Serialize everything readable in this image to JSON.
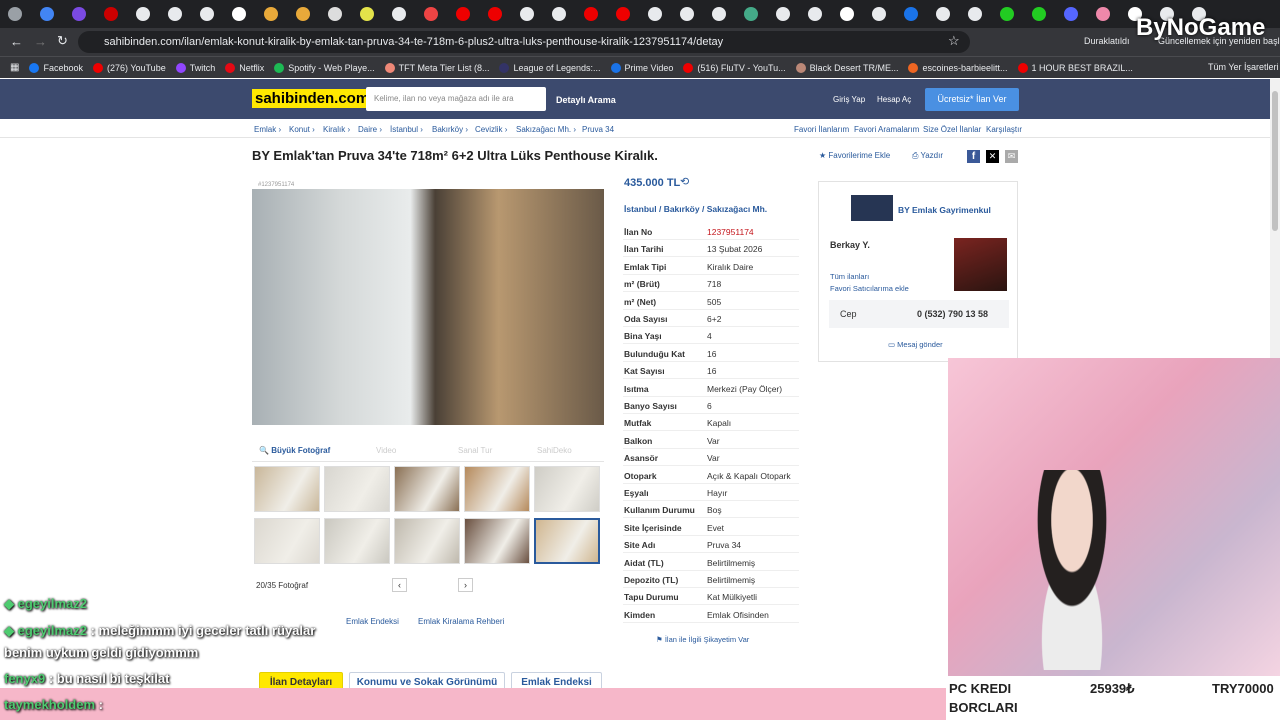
{
  "browser": {
    "url": "sahibinden.com/ilan/emlak-konut-kiralik-by-emlak-tan-pruva-34-te-718m-6-plus2-ultra-luks-penthouse-kiralik-1237951174/detay",
    "profile_label": "Duraklatıldı",
    "update_label": "Güncellemek için yeniden başlat",
    "bookmarks": [
      "Facebook",
      "(276) YouTube",
      "Twitch",
      "Netflix",
      "Spotify - Web Playe...",
      "TFT Meta Tier List (8...",
      "League of Legends:...",
      "Prime Video",
      "(516) FluTV - YouTu...",
      "Black Desert TR/ME...",
      "escoines-barbieelitt...",
      "1 HOUR BEST BRAZIL..."
    ],
    "all_bookmarks": "Tüm Yer İşaretleri"
  },
  "site": {
    "logo": "sahibinden.com",
    "search_placeholder": "Kelime, ilan no veya mağaza adı ile ara",
    "detailed_search": "Detaylı Arama",
    "login": "Giriş Yap",
    "register": "Hesap Aç",
    "post_ad": "Ücretsiz* İlan Ver"
  },
  "breadcrumb": [
    "Emlak",
    "Konut",
    "Kiralık",
    "Daire",
    "İstanbul",
    "Bakırköy",
    "Cevizlik",
    "Sakızağacı Mh.",
    "Pruva 34"
  ],
  "crumb_links": [
    "Favori İlanlarım",
    "Favori Aramalarım",
    "Size Özel İlanlar",
    "Karşılaştır"
  ],
  "listing": {
    "title": "BY Emlak'tan Pruva 34'te 718m² 6+2 Ultra Lüks Penthouse Kiralık.",
    "fav_label": "Favorilerime Ekle",
    "print_label": "Yazdır",
    "photo_id": "#1237951174",
    "price": "435.000 TL",
    "location": [
      "İstanbul",
      "Bakırköy",
      "Sakızağacı Mh."
    ],
    "media_tabs": [
      "Büyük Fotoğraf",
      "Video",
      "Sanal Tur",
      "SahiDeko"
    ],
    "photo_count": "20/35 Fotoğraf",
    "links_below": [
      "Emlak Endeksi",
      "Emlak Kiralama Rehberi"
    ],
    "report_label": "İlan ile İlgili Şikayetim Var",
    "detail_tabs": [
      "İlan Detayları",
      "Konumu ve Sokak Görünümü",
      "Emlak Endeksi"
    ]
  },
  "details": [
    {
      "k": "İlan No",
      "v": "1237951174"
    },
    {
      "k": "İlan Tarihi",
      "v": "13 Şubat 2026"
    },
    {
      "k": "Emlak Tipi",
      "v": "Kiralık Daire"
    },
    {
      "k": "m² (Brüt)",
      "v": "718"
    },
    {
      "k": "m² (Net)",
      "v": "505"
    },
    {
      "k": "Oda Sayısı",
      "v": "6+2"
    },
    {
      "k": "Bina Yaşı",
      "v": "4"
    },
    {
      "k": "Bulunduğu Kat",
      "v": "16"
    },
    {
      "k": "Kat Sayısı",
      "v": "16"
    },
    {
      "k": "Isıtma",
      "v": "Merkezi (Pay Ölçer)"
    },
    {
      "k": "Banyo Sayısı",
      "v": "6"
    },
    {
      "k": "Mutfak",
      "v": "Kapalı"
    },
    {
      "k": "Balkon",
      "v": "Var"
    },
    {
      "k": "Asansör",
      "v": "Var"
    },
    {
      "k": "Otopark",
      "v": "Açık & Kapalı Otopark"
    },
    {
      "k": "Eşyalı",
      "v": "Hayır"
    },
    {
      "k": "Kullanım Durumu",
      "v": "Boş"
    },
    {
      "k": "Site İçerisinde",
      "v": "Evet"
    },
    {
      "k": "Site Adı",
      "v": "Pruva 34"
    },
    {
      "k": "Aidat (TL)",
      "v": "Belirtilmemiş"
    },
    {
      "k": "Depozito (TL)",
      "v": "Belirtilmemiş"
    },
    {
      "k": "Tapu Durumu",
      "v": "Kat Mülkiyetli"
    },
    {
      "k": "Kimden",
      "v": "Emlak Ofisinden"
    }
  ],
  "seller": {
    "store": "BY Emlak Gayrimenkul",
    "name": "Berkay Y.",
    "all_ads": "Tüm ilanları",
    "fav_seller": "Favori Satıcılarıma ekle",
    "phone_label": "Cep",
    "phone": "0 (532) 790 13 58",
    "message": "Mesaj gönder"
  },
  "stream": {
    "watermark": "ByNoGame",
    "chat": [
      {
        "user": "egeyilmaz2",
        "msg": ""
      },
      {
        "user": "egeyilmaz2",
        "msg": ": meleğimmm iyi geceler tatlı rüyalar"
      },
      {
        "user": "",
        "msg": "benim uykum geldi gidiyommm"
      },
      {
        "user": "fenyx9",
        "msg": ": bu nasıl bi teşkilat"
      },
      {
        "user": "taymekholdem",
        "msg": ":"
      }
    ],
    "debt_title_1": "PC KREDI",
    "debt_title_2": "BORCLARI",
    "debt_value": "25939₺",
    "debt_try": "TRY70000"
  }
}
